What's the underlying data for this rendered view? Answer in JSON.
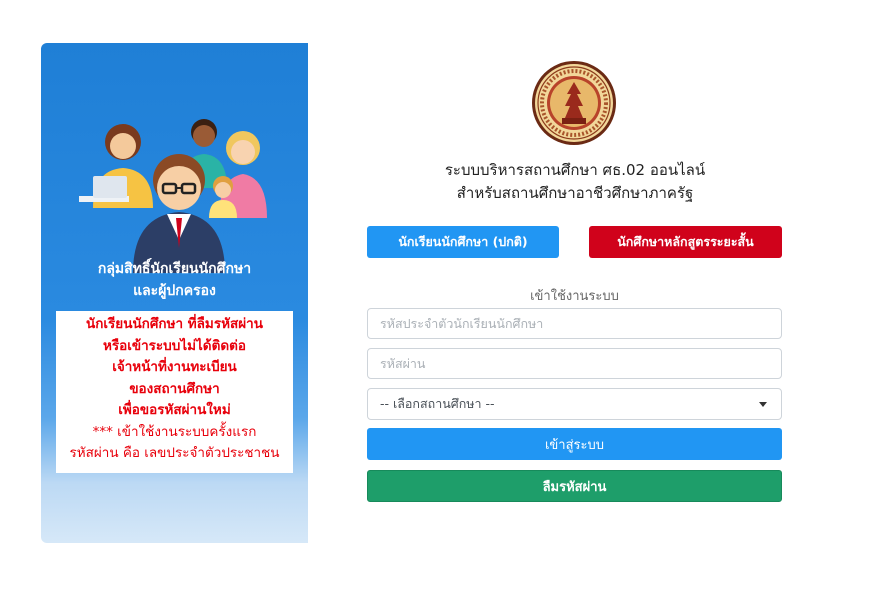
{
  "left_panel": {
    "group_title_line1": "กลุ่มสิทธิ์นักเรียนนักศึกษา",
    "group_title_line2": "และผู้ปกครอง",
    "notice_lines": [
      "นักเรียนนักศึกษา ที่ลืมรหัสผ่าน",
      "หรือเข้าระบบไม่ได้ติดต่อ",
      "เจ้าหน้าที่งานทะเบียน",
      "ของสถานศึกษา",
      "เพื่อขอรหัสผ่านใหม่"
    ],
    "first_login_line1": "*** เข้าใช้งานระบบครั้งแรก",
    "first_login_line2": "รหัสผ่าน คือ เลขประจำตัวประชาชน",
    "illustration_icon": "students-and-parents-illustration"
  },
  "header": {
    "seal_icon": "vocational-education-commission-seal",
    "seal_text": "สำนักงานคณะกรรมการการอาชีวศึกษา",
    "title_line1": "ระบบบริหารสถานศึกษา ศธ.02 ออนไลน์",
    "title_line2": "สำหรับสถานศึกษาอาชีวศึกษาภาครัฐ"
  },
  "tabs": {
    "student_normal": "นักเรียนนักศึกษา (ปกติ)",
    "student_short_course": "นักศึกษาหลักสูตรระยะสั้น"
  },
  "login": {
    "heading": "เข้าใช้งานระบบ",
    "id_placeholder": "รหัสประจำตัวนักเรียนนักศึกษา",
    "password_placeholder": "รหัสผ่าน",
    "institution_select": "-- เลือกสถานศึกษา --",
    "submit_label": "เข้าสู่ระบบ",
    "forgot_label": "ลืมรหัสผ่าน"
  },
  "colors": {
    "panel_blue": "#1f7fd6",
    "primary": "#2196f3",
    "danger": "#d0021b",
    "success": "#1e9e6a",
    "notice_red": "#e8000b"
  }
}
